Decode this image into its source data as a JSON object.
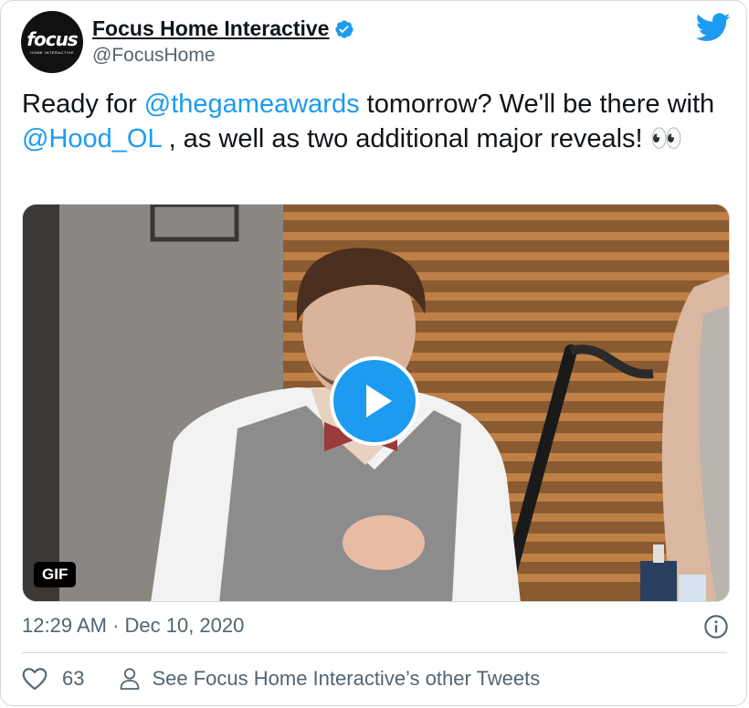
{
  "author": {
    "display_name": "Focus Home Interactive",
    "handle": "@FocusHome",
    "avatar_logo_text": "focus",
    "avatar_logo_subtext": "HOME INTERACTIVE",
    "verified_icon": "verified-badge-icon"
  },
  "tweet": {
    "text_part_1": "Ready for ",
    "mention_1": "@thegameawards",
    "text_part_2": " tomorrow? We'll be there with ",
    "mention_2": "@Hood_OL",
    "text_part_3": " , as well as two additional major reveals! ",
    "emoji": "👀"
  },
  "media": {
    "badge_label": "GIF",
    "play_icon": "play-icon"
  },
  "meta": {
    "timestamp": "12:29 AM · Dec 10, 2020"
  },
  "actions": {
    "like_icon": "heart-icon",
    "like_count": "63",
    "profile_icon": "person-icon",
    "see_more_label": "See Focus Home Interactive’s other Tweets"
  },
  "colors": {
    "accent": "#1d9bf0",
    "text": "#0f1419",
    "secondary_text": "#536471",
    "border": "#cfd9de"
  }
}
